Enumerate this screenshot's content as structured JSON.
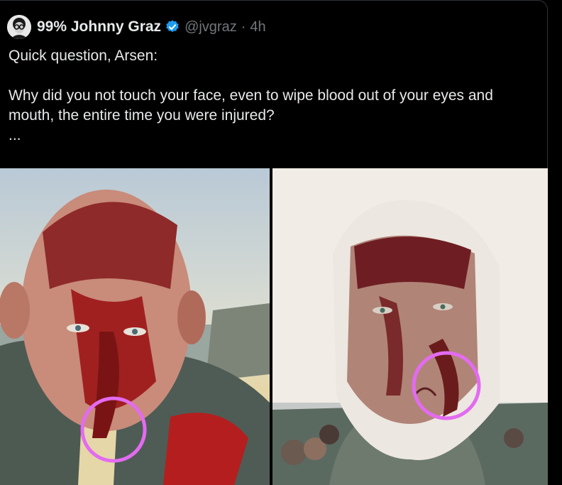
{
  "tweet": {
    "display_name": "99% Johnny Graz",
    "handle": "@jvgraz",
    "separator": "·",
    "time": "4h",
    "text": "Quick question, Arsen:\n\nWhy did you not touch your face, even to wipe blood out of your eyes and mouth, the entire time you were injured?\n...",
    "verified_icon": "verified-badge-icon",
    "avatar_icon": "avatar-glasses-icon"
  },
  "media": {
    "left_photo": "bloodied-face-selfie",
    "right_photo": "bandaged-bloodied-face",
    "highlight_color": "#e36bf0"
  },
  "colors": {
    "background": "#000000",
    "text": "#e7e9ea",
    "secondary": "#71767b",
    "verified": "#1d9bf0"
  }
}
